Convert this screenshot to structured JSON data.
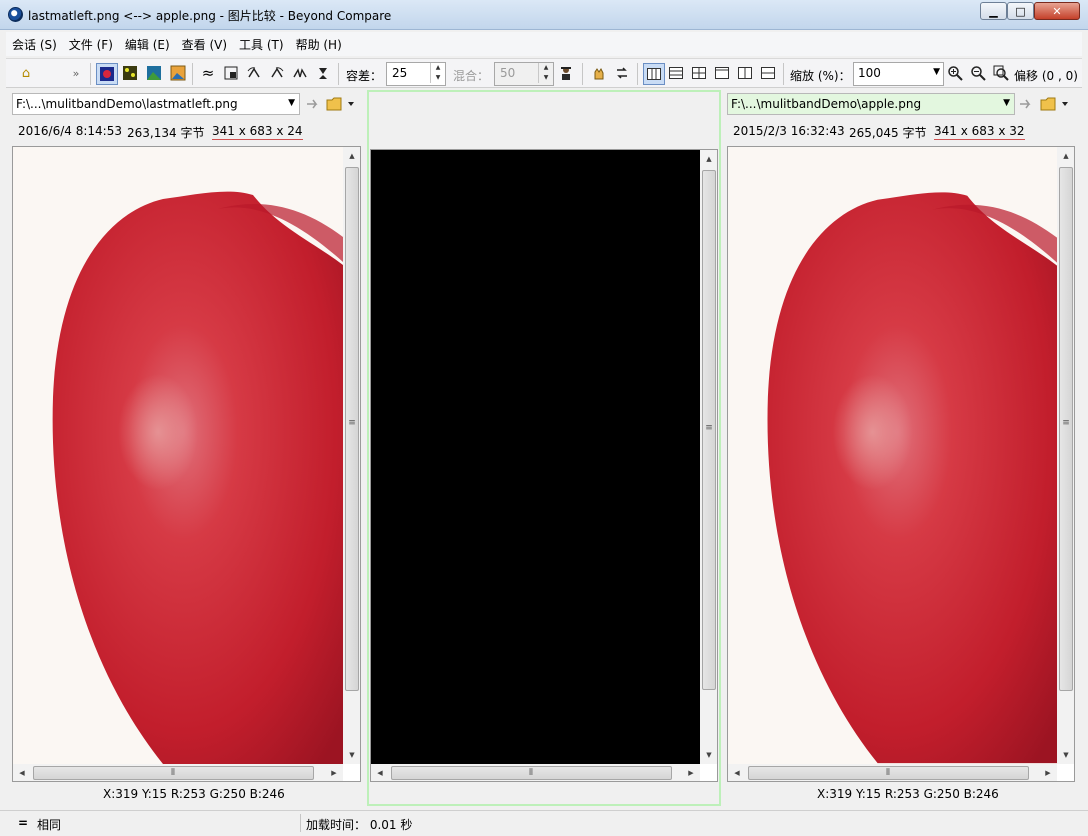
{
  "window": {
    "title": "lastmatleft.png <--> apple.png - 图片比较 - Beyond Compare",
    "min": "▁",
    "max": "□",
    "close": "✕"
  },
  "menu": [
    "会话 (S)",
    "文件 (F)",
    "编辑 (E)",
    "查看 (V)",
    "工具 (T)",
    "帮助 (H)"
  ],
  "toolbar": {
    "home": "⌂",
    "overflow": "»",
    "approx": "≈",
    "tolerance_label": "容差：",
    "tolerance_value": "25",
    "blend_label": "混合：",
    "blend_value": "50",
    "zoom_label": "缩放 (%)：",
    "zoom_value": "100",
    "offset_label": "偏移 (0 , 0)"
  },
  "left": {
    "path": "F:\\...\\mulitbandDemo\\lastmatleft.png",
    "date": "2016/6/4 8:14:53",
    "size": "263,134 字节",
    "dims": "341 x 683 x 24",
    "pixel": "X:319 Y:15 R:253 G:250 B:246"
  },
  "right": {
    "path": "F:\\...\\mulitbandDemo\\apple.png",
    "date": "2015/2/3 16:32:43",
    "size": "265,045 字节",
    "dims": "341 x 683 x 32",
    "pixel": "X:319 Y:15 R:253 G:250 B:246"
  },
  "status": {
    "icon": "=",
    "state": "相同",
    "load_time": "加载时间： 0.01 秒"
  }
}
